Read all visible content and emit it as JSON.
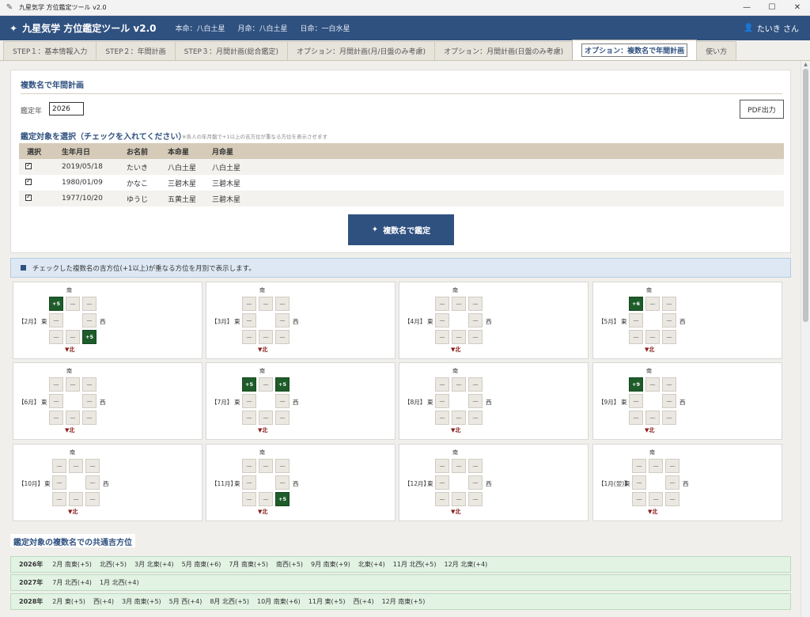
{
  "window": {
    "title": "九星気学 方位鑑定ツール v2.0",
    "controls": [
      "—",
      "☐",
      "✕"
    ]
  },
  "header": {
    "app_title": "九星気学 方位鑑定ツール v2.0",
    "honmei": "本命：八白土星",
    "getsumei": "月命：八白土星",
    "nichimei": "日命：一白水星",
    "user": "たいき さん"
  },
  "tabs": [
    {
      "label": "STEP１：基本情報入力",
      "active": false
    },
    {
      "label": "STEP２：年間計画",
      "active": false
    },
    {
      "label": "STEP３：月間計画(総合鑑定)",
      "active": false
    },
    {
      "label": "オプション：月間計画(月/日盤のみ考慮)",
      "active": false
    },
    {
      "label": "オプション：月間計画(日盤のみ考慮)",
      "active": false
    },
    {
      "label": "オプション：複数名で年間計画",
      "active": true
    },
    {
      "label": "使い方",
      "active": false
    }
  ],
  "panel": {
    "title": "複数名で年間計画",
    "year_label": "鑑定年",
    "year_value": "2026",
    "pdf_button": "PDF出力",
    "select_title": "鑑定対象を選択（チェックを入れてください）",
    "select_note": "※各人の年月盤で+1以上の吉方位が重なる方位を表示させます",
    "columns": [
      "選択",
      "生年月日",
      "お名前",
      "本命星",
      "月命星"
    ],
    "people": [
      {
        "checked": true,
        "dob": "2019/05/18",
        "name": "たいき",
        "honmei": "八白土星",
        "getsumei": "八白土星"
      },
      {
        "checked": true,
        "dob": "1980/01/09",
        "name": "かなこ",
        "honmei": "三碧木星",
        "getsumei": "三碧木星"
      },
      {
        "checked": true,
        "dob": "1977/10/20",
        "name": "ゆうじ",
        "honmei": "五黄土星",
        "getsumei": "三碧木星"
      }
    ],
    "run_button": "複数名で鑑定"
  },
  "info_text": "チェックした複数名の吉方位(+1以上)が重なる方位を月別で表示します。",
  "compass": {
    "south": "南",
    "north": "▼北",
    "east": "東",
    "west": "西",
    "empty": "—"
  },
  "months": [
    {
      "label": "【2月】",
      "cells": {
        "SE": "+5",
        "NW": "+5"
      }
    },
    {
      "label": "【3月】",
      "cells": {}
    },
    {
      "label": "【4月】",
      "cells": {}
    },
    {
      "label": "【5月】",
      "cells": {
        "SE": "+6"
      }
    },
    {
      "label": "【6月】",
      "cells": {}
    },
    {
      "label": "【7月】",
      "cells": {
        "SE": "+5",
        "SW": "+5"
      }
    },
    {
      "label": "【8月】",
      "cells": {}
    },
    {
      "label": "【9月】",
      "cells": {
        "SE": "+9"
      }
    },
    {
      "label": "【10月】",
      "cells": {}
    },
    {
      "label": "【11月】",
      "cells": {
        "NW": "+5"
      }
    },
    {
      "label": "【12月】",
      "cells": {}
    },
    {
      "label": "【1月(翌)】",
      "cells": {}
    }
  ],
  "common": {
    "title": "鑑定対象の複数名での共通吉方位",
    "rows": [
      {
        "year": "2026年",
        "items": [
          "2月 南東(+5)",
          "北西(+5)",
          "3月 北東(+4)",
          "5月 南東(+6)",
          "7月 南東(+5)",
          "南西(+5)",
          "9月 南東(+9)",
          "北東(+4)",
          "11月 北西(+5)",
          "12月 北東(+4)"
        ]
      },
      {
        "year": "2027年",
        "items": [
          "7月 北西(+4)",
          "1月 北西(+4)"
        ]
      },
      {
        "year": "2028年",
        "items": [
          "2月 東(+5)",
          "西(+4)",
          "3月 南東(+5)",
          "5月 西(+4)",
          "8月 北西(+5)",
          "10月 南東(+6)",
          "11月 東(+5)",
          "西(+4)",
          "12月 南東(+5)"
        ]
      }
    ]
  },
  "colors": {
    "header_bg": "#2f5180",
    "good_cell": "#1e5c2a",
    "table_header": "#d5cbb8",
    "info_bg": "#dde8f4",
    "common_row_bg": "#e2f3e4"
  }
}
